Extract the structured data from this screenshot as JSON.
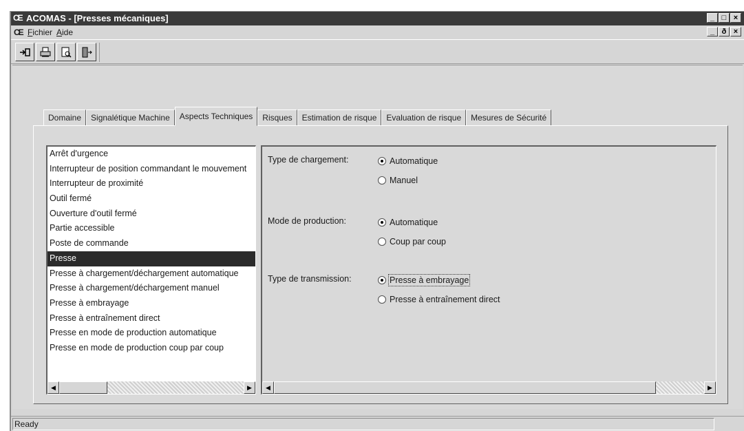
{
  "window": {
    "app_logo": "CE",
    "title": "ACOMAS - [Presses mécaniques]",
    "buttons": {
      "minimize": "_",
      "restore": "□",
      "close": "×",
      "mdi_restore": "ð"
    }
  },
  "menubar": {
    "doc_logo": "CE",
    "items": [
      "Fichier",
      "Aide"
    ]
  },
  "toolbar": {
    "buttons": [
      "new-icon",
      "print-icon",
      "print-preview-icon",
      "exit-icon"
    ]
  },
  "tabs": [
    {
      "label": "Domaine"
    },
    {
      "label": "Signalétique Machine"
    },
    {
      "label": "Aspects Techniques",
      "active": true
    },
    {
      "label": "Risques"
    },
    {
      "label": "Estimation de risque"
    },
    {
      "label": "Evaluation de risque"
    },
    {
      "label": "Mesures de Sécurité"
    }
  ],
  "list": {
    "items": [
      "Arrêt d'urgence",
      "Interrupteur de position commandant le mouvement",
      "Interrupteur de proximité",
      "Outil fermé",
      "Ouverture d'outil fermé",
      "Partie accessible",
      "Poste de commande",
      "Presse",
      "Presse à chargement/déchargement automatique",
      "Presse à chargement/déchargement manuel",
      "Presse à embrayage",
      "Presse à entraînement direct",
      "Presse en mode de production automatique",
      "Presse en mode de production coup par coup"
    ],
    "selected_index": 7
  },
  "options": {
    "chargement": {
      "label": "Type de chargement:",
      "choices": [
        "Automatique",
        "Manuel"
      ],
      "selected": "Automatique"
    },
    "production": {
      "label": "Mode de production:",
      "choices": [
        "Automatique",
        "Coup par coup"
      ],
      "selected": "Automatique"
    },
    "transmission": {
      "label": "Type de transmission:",
      "choices": [
        "Presse à embrayage",
        "Presse à entraînement direct"
      ],
      "selected": "Presse à embrayage"
    }
  },
  "status": {
    "text": "Ready"
  }
}
